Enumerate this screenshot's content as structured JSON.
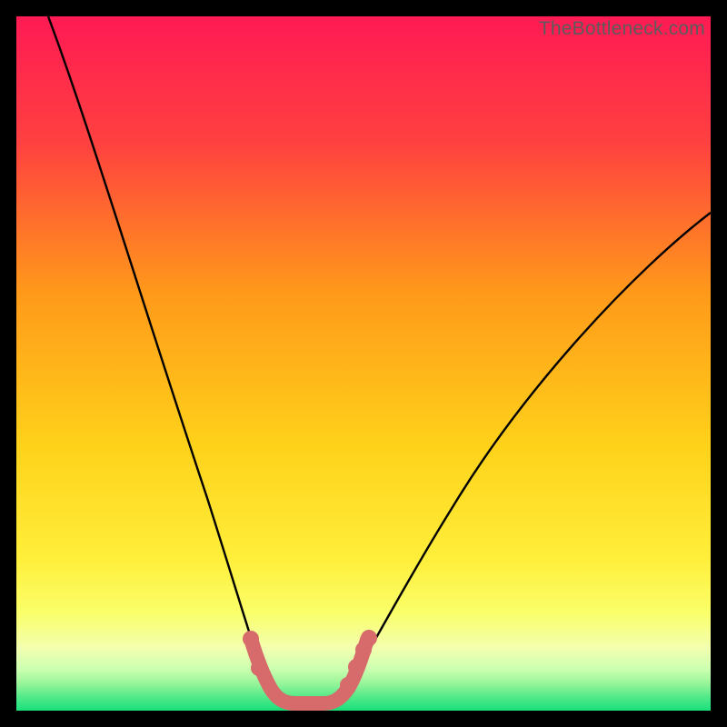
{
  "watermark": "TheBottleneck.com",
  "chart_data": {
    "type": "line",
    "title": "",
    "xlabel": "",
    "ylabel": "",
    "xlim": [
      0,
      100
    ],
    "ylim": [
      0,
      100
    ],
    "series": [
      {
        "name": "bottleneck-curve",
        "color": "#000000",
        "x": [
          2,
          6,
          10,
          14,
          18,
          22,
          26,
          30,
          33,
          35,
          37,
          39,
          41,
          43,
          45,
          47,
          50,
          55,
          60,
          65,
          70,
          75,
          80,
          85,
          90,
          95,
          100
        ],
        "y": [
          100,
          89,
          78,
          67,
          56,
          45,
          35,
          25,
          16,
          10,
          5,
          2,
          1,
          1,
          2,
          5,
          10,
          18,
          26,
          34,
          42,
          49,
          56,
          62,
          67,
          71,
          73
        ]
      },
      {
        "name": "optimal-band",
        "color": "#d76a6a",
        "x": [
          34,
          35,
          36,
          37,
          38,
          39,
          40,
          41,
          42,
          43,
          44,
          45,
          46,
          47,
          48
        ],
        "y": [
          10,
          7,
          5,
          4,
          3,
          2,
          2,
          2,
          2,
          2,
          3,
          4,
          5,
          7,
          10
        ]
      }
    ],
    "background_gradient": {
      "top_color": "#ff1a54",
      "mid_color": "#ffe200",
      "bottom_color": "#18e07a"
    }
  }
}
